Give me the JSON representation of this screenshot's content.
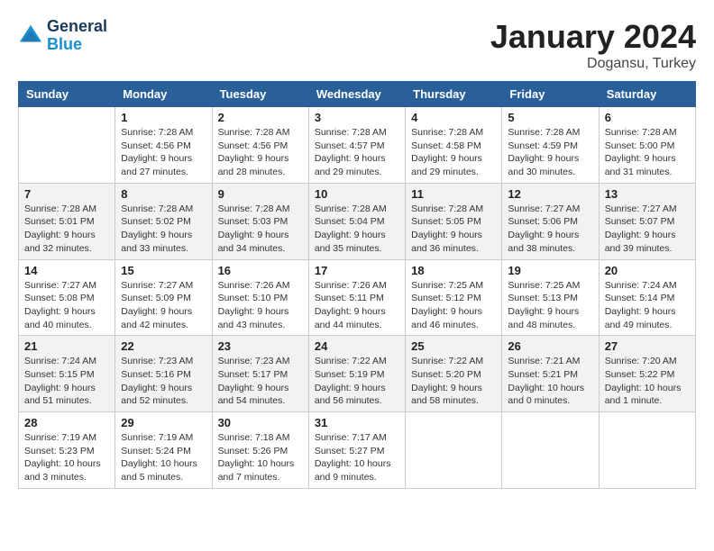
{
  "header": {
    "logo_line1": "General",
    "logo_line2": "Blue",
    "month": "January 2024",
    "location": "Dogansu, Turkey"
  },
  "weekdays": [
    "Sunday",
    "Monday",
    "Tuesday",
    "Wednesday",
    "Thursday",
    "Friday",
    "Saturday"
  ],
  "weeks": [
    [
      {
        "day": "",
        "sunrise": "",
        "sunset": "",
        "daylight": ""
      },
      {
        "day": "1",
        "sunrise": "Sunrise: 7:28 AM",
        "sunset": "Sunset: 4:56 PM",
        "daylight": "Daylight: 9 hours and 27 minutes."
      },
      {
        "day": "2",
        "sunrise": "Sunrise: 7:28 AM",
        "sunset": "Sunset: 4:56 PM",
        "daylight": "Daylight: 9 hours and 28 minutes."
      },
      {
        "day": "3",
        "sunrise": "Sunrise: 7:28 AM",
        "sunset": "Sunset: 4:57 PM",
        "daylight": "Daylight: 9 hours and 29 minutes."
      },
      {
        "day": "4",
        "sunrise": "Sunrise: 7:28 AM",
        "sunset": "Sunset: 4:58 PM",
        "daylight": "Daylight: 9 hours and 29 minutes."
      },
      {
        "day": "5",
        "sunrise": "Sunrise: 7:28 AM",
        "sunset": "Sunset: 4:59 PM",
        "daylight": "Daylight: 9 hours and 30 minutes."
      },
      {
        "day": "6",
        "sunrise": "Sunrise: 7:28 AM",
        "sunset": "Sunset: 5:00 PM",
        "daylight": "Daylight: 9 hours and 31 minutes."
      }
    ],
    [
      {
        "day": "7",
        "sunrise": "Sunrise: 7:28 AM",
        "sunset": "Sunset: 5:01 PM",
        "daylight": "Daylight: 9 hours and 32 minutes."
      },
      {
        "day": "8",
        "sunrise": "Sunrise: 7:28 AM",
        "sunset": "Sunset: 5:02 PM",
        "daylight": "Daylight: 9 hours and 33 minutes."
      },
      {
        "day": "9",
        "sunrise": "Sunrise: 7:28 AM",
        "sunset": "Sunset: 5:03 PM",
        "daylight": "Daylight: 9 hours and 34 minutes."
      },
      {
        "day": "10",
        "sunrise": "Sunrise: 7:28 AM",
        "sunset": "Sunset: 5:04 PM",
        "daylight": "Daylight: 9 hours and 35 minutes."
      },
      {
        "day": "11",
        "sunrise": "Sunrise: 7:28 AM",
        "sunset": "Sunset: 5:05 PM",
        "daylight": "Daylight: 9 hours and 36 minutes."
      },
      {
        "day": "12",
        "sunrise": "Sunrise: 7:27 AM",
        "sunset": "Sunset: 5:06 PM",
        "daylight": "Daylight: 9 hours and 38 minutes."
      },
      {
        "day": "13",
        "sunrise": "Sunrise: 7:27 AM",
        "sunset": "Sunset: 5:07 PM",
        "daylight": "Daylight: 9 hours and 39 minutes."
      }
    ],
    [
      {
        "day": "14",
        "sunrise": "Sunrise: 7:27 AM",
        "sunset": "Sunset: 5:08 PM",
        "daylight": "Daylight: 9 hours and 40 minutes."
      },
      {
        "day": "15",
        "sunrise": "Sunrise: 7:27 AM",
        "sunset": "Sunset: 5:09 PM",
        "daylight": "Daylight: 9 hours and 42 minutes."
      },
      {
        "day": "16",
        "sunrise": "Sunrise: 7:26 AM",
        "sunset": "Sunset: 5:10 PM",
        "daylight": "Daylight: 9 hours and 43 minutes."
      },
      {
        "day": "17",
        "sunrise": "Sunrise: 7:26 AM",
        "sunset": "Sunset: 5:11 PM",
        "daylight": "Daylight: 9 hours and 44 minutes."
      },
      {
        "day": "18",
        "sunrise": "Sunrise: 7:25 AM",
        "sunset": "Sunset: 5:12 PM",
        "daylight": "Daylight: 9 hours and 46 minutes."
      },
      {
        "day": "19",
        "sunrise": "Sunrise: 7:25 AM",
        "sunset": "Sunset: 5:13 PM",
        "daylight": "Daylight: 9 hours and 48 minutes."
      },
      {
        "day": "20",
        "sunrise": "Sunrise: 7:24 AM",
        "sunset": "Sunset: 5:14 PM",
        "daylight": "Daylight: 9 hours and 49 minutes."
      }
    ],
    [
      {
        "day": "21",
        "sunrise": "Sunrise: 7:24 AM",
        "sunset": "Sunset: 5:15 PM",
        "daylight": "Daylight: 9 hours and 51 minutes."
      },
      {
        "day": "22",
        "sunrise": "Sunrise: 7:23 AM",
        "sunset": "Sunset: 5:16 PM",
        "daylight": "Daylight: 9 hours and 52 minutes."
      },
      {
        "day": "23",
        "sunrise": "Sunrise: 7:23 AM",
        "sunset": "Sunset: 5:17 PM",
        "daylight": "Daylight: 9 hours and 54 minutes."
      },
      {
        "day": "24",
        "sunrise": "Sunrise: 7:22 AM",
        "sunset": "Sunset: 5:19 PM",
        "daylight": "Daylight: 9 hours and 56 minutes."
      },
      {
        "day": "25",
        "sunrise": "Sunrise: 7:22 AM",
        "sunset": "Sunset: 5:20 PM",
        "daylight": "Daylight: 9 hours and 58 minutes."
      },
      {
        "day": "26",
        "sunrise": "Sunrise: 7:21 AM",
        "sunset": "Sunset: 5:21 PM",
        "daylight": "Daylight: 10 hours and 0 minutes."
      },
      {
        "day": "27",
        "sunrise": "Sunrise: 7:20 AM",
        "sunset": "Sunset: 5:22 PM",
        "daylight": "Daylight: 10 hours and 1 minute."
      }
    ],
    [
      {
        "day": "28",
        "sunrise": "Sunrise: 7:19 AM",
        "sunset": "Sunset: 5:23 PM",
        "daylight": "Daylight: 10 hours and 3 minutes."
      },
      {
        "day": "29",
        "sunrise": "Sunrise: 7:19 AM",
        "sunset": "Sunset: 5:24 PM",
        "daylight": "Daylight: 10 hours and 5 minutes."
      },
      {
        "day": "30",
        "sunrise": "Sunrise: 7:18 AM",
        "sunset": "Sunset: 5:26 PM",
        "daylight": "Daylight: 10 hours and 7 minutes."
      },
      {
        "day": "31",
        "sunrise": "Sunrise: 7:17 AM",
        "sunset": "Sunset: 5:27 PM",
        "daylight": "Daylight: 10 hours and 9 minutes."
      },
      {
        "day": "",
        "sunrise": "",
        "sunset": "",
        "daylight": ""
      },
      {
        "day": "",
        "sunrise": "",
        "sunset": "",
        "daylight": ""
      },
      {
        "day": "",
        "sunrise": "",
        "sunset": "",
        "daylight": ""
      }
    ]
  ]
}
